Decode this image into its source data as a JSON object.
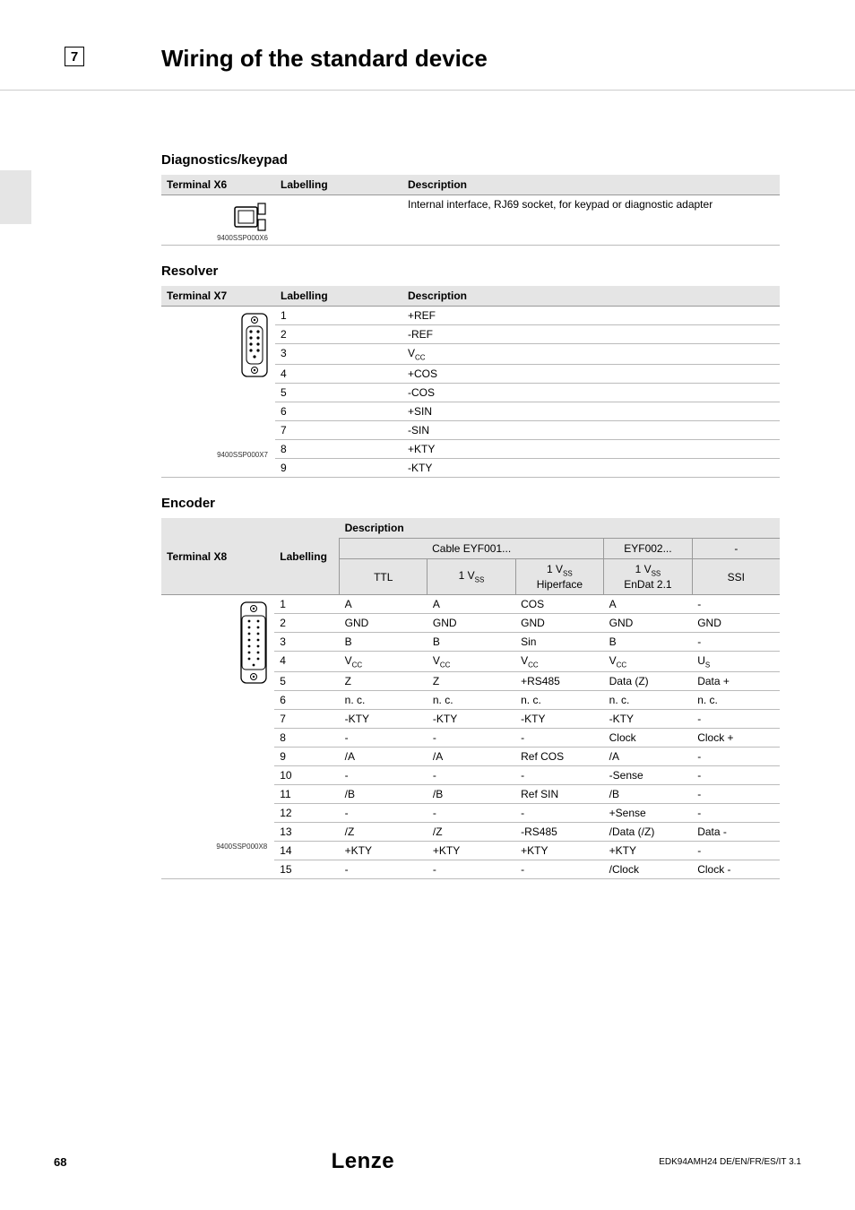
{
  "chapter_num": "7",
  "page_title": "Wiring of the standard device",
  "sect1": {
    "title": "Diagnostics/keypad",
    "col1": "Terminal X6",
    "col2": "Labelling",
    "col3": "Description",
    "img_label": "9400SSP000X6",
    "row1_desc": "Internal interface, RJ69 socket, for keypad or diagnostic adapter"
  },
  "sect2": {
    "title": "Resolver",
    "col1": "Terminal X7",
    "col2": "Labelling",
    "col3": "Description",
    "img_label": "9400SSP000X7",
    "rows": [
      {
        "l": "1",
        "d": "+REF"
      },
      {
        "l": "2",
        "d": "-REF"
      },
      {
        "l": "3",
        "d": "V",
        "dsub": "CC"
      },
      {
        "l": "4",
        "d": "+COS"
      },
      {
        "l": "5",
        "d": "-COS"
      },
      {
        "l": "6",
        "d": "+SIN"
      },
      {
        "l": "7",
        "d": "-SIN"
      },
      {
        "l": "8",
        "d": "+KTY"
      },
      {
        "l": "9",
        "d": "-KTY"
      }
    ]
  },
  "sect3": {
    "title": "Encoder",
    "col1": "Terminal X8",
    "col2": "Labelling",
    "col3": "Description",
    "img_label": "9400SSP000X8",
    "group1": "Cable EYF001...",
    "group2": "EYF002...",
    "group3": "-",
    "sub_cols": [
      "TTL",
      "1 V_SS",
      "1 V_SS\nHiperface",
      "1 V_SS\nEnDat 2.1",
      "SSI"
    ],
    "rows": [
      {
        "l": "1",
        "c": [
          "A",
          "A",
          "COS",
          "A",
          "-"
        ]
      },
      {
        "l": "2",
        "c": [
          "GND",
          "GND",
          "GND",
          "GND",
          "GND"
        ]
      },
      {
        "l": "3",
        "c": [
          "B",
          "B",
          "Sin",
          "B",
          "-"
        ]
      },
      {
        "l": "4",
        "c": [
          "V_CC",
          "V_CC",
          "V_CC",
          "V_CC",
          "U_S"
        ]
      },
      {
        "l": "5",
        "c": [
          "Z",
          "Z",
          "+RS485",
          "Data (Z)",
          "Data +"
        ]
      },
      {
        "l": "6",
        "c": [
          "n. c.",
          "n. c.",
          "n. c.",
          "n. c.",
          "n. c."
        ]
      },
      {
        "l": "7",
        "c": [
          "-KTY",
          "-KTY",
          "-KTY",
          "-KTY",
          "-"
        ]
      },
      {
        "l": "8",
        "c": [
          "-",
          "-",
          "-",
          "Clock",
          "Clock +"
        ]
      },
      {
        "l": "9",
        "c": [
          "/A",
          "/A",
          "Ref COS",
          "/A",
          "-"
        ]
      },
      {
        "l": "10",
        "c": [
          "-",
          "-",
          "-",
          "-Sense",
          "-"
        ]
      },
      {
        "l": "11",
        "c": [
          "/B",
          "/B",
          "Ref SIN",
          "/B",
          "-"
        ]
      },
      {
        "l": "12",
        "c": [
          "-",
          "-",
          "-",
          "+Sense",
          "-"
        ]
      },
      {
        "l": "13",
        "c": [
          "/Z",
          "/Z",
          "-RS485",
          "/Data (/Z)",
          "Data -"
        ]
      },
      {
        "l": "14",
        "c": [
          "+KTY",
          "+KTY",
          "+KTY",
          "+KTY",
          "-"
        ]
      },
      {
        "l": "15",
        "c": [
          "-",
          "-",
          "-",
          "/Clock",
          "Clock -"
        ]
      }
    ]
  },
  "footer": {
    "page": "68",
    "logo": "Lenze",
    "doc": "EDK94AMH24  DE/EN/FR/ES/IT  3.1"
  }
}
